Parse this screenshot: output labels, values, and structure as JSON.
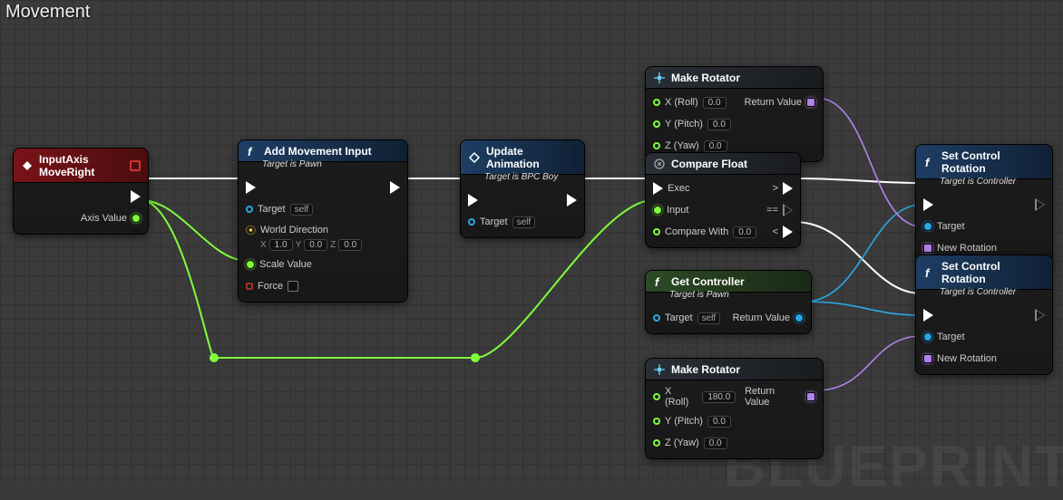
{
  "title": "Movement",
  "watermark": "BLUEPRINT",
  "nodes": {
    "inputAxis": {
      "title": "InputAxis MoveRight",
      "pins": {
        "axisValue": "Axis Value"
      }
    },
    "addMove": {
      "title": "Add Movement Input",
      "subtitle": "Target is Pawn",
      "pins": {
        "target": "Target",
        "targetVal": "self",
        "worldDir": "World Direction",
        "wx": "1.0",
        "wy": "0.0",
        "wz": "0.0",
        "scale": "Scale Value",
        "force": "Force"
      }
    },
    "updateAnim": {
      "title": "Update Animation",
      "subtitle": "Target is BPC Boy",
      "pins": {
        "target": "Target",
        "targetVal": "self"
      }
    },
    "compare": {
      "title": "Compare Float",
      "pins": {
        "exec": "Exec",
        "input": "Input",
        "cwith": "Compare With",
        "cwithVal": "0.0",
        "gt": ">",
        "eq": "==",
        "lt": "<"
      }
    },
    "makeRot1": {
      "title": "Make Rotator",
      "pins": {
        "x": "X (Roll)",
        "y": "Y (Pitch)",
        "z": "Z (Yaw)",
        "xv": "0.0",
        "yv": "0.0",
        "zv": "0.0",
        "ret": "Return Value"
      }
    },
    "makeRot2": {
      "title": "Make Rotator",
      "pins": {
        "x": "X (Roll)",
        "y": "Y (Pitch)",
        "z": "Z (Yaw)",
        "xv": "180.0",
        "yv": "0.0",
        "zv": "0.0",
        "ret": "Return Value"
      }
    },
    "getCtrl": {
      "title": "Get Controller",
      "subtitle": "Target is Pawn",
      "pins": {
        "target": "Target",
        "targetVal": "self",
        "ret": "Return Value"
      }
    },
    "setRot1": {
      "title": "Set Control Rotation",
      "subtitle": "Target is Controller",
      "pins": {
        "target": "Target",
        "newRot": "New Rotation"
      }
    },
    "setRot2": {
      "title": "Set Control Rotation",
      "subtitle": "Target is Controller",
      "pins": {
        "target": "Target",
        "newRot": "New Rotation"
      }
    }
  }
}
